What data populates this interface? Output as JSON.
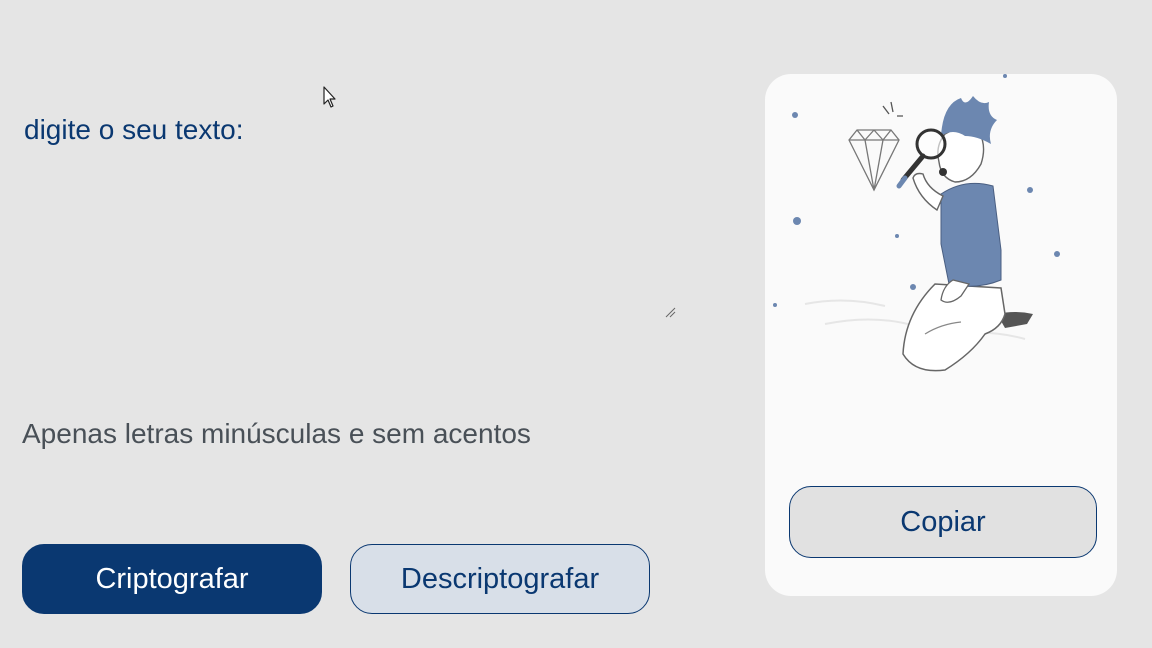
{
  "input": {
    "placeholder": "digite o seu texto:",
    "value": ""
  },
  "hint": {
    "text": "Apenas letras minúsculas e sem acentos"
  },
  "actions": {
    "encrypt_label": "Criptografar",
    "decrypt_label": "Descriptografar"
  },
  "output_panel": {
    "copy_label": "Copiar",
    "illustration": "person-with-magnifier-illustration"
  },
  "colors": {
    "background": "#e5e5e5",
    "accent": "#0a3871",
    "hint_text": "#495057",
    "panel": "#fafafa",
    "secondary_button": "#d8dfe8",
    "illustration_blue": "#6c87b0"
  },
  "icons": {
    "cursor": "mouse-pointer-icon",
    "resize": "resize-grip-icon",
    "diamond": "diamond-icon",
    "magnifier": "magnifying-glass-icon"
  }
}
